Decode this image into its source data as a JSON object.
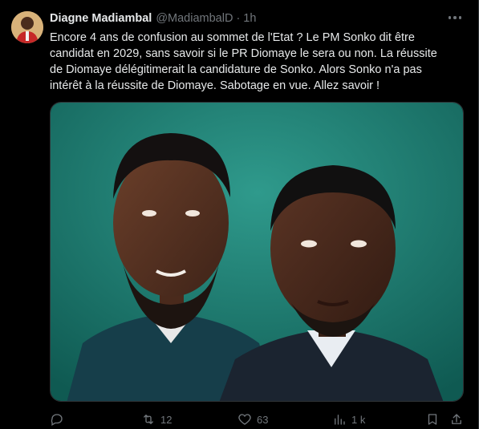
{
  "tweet": {
    "author_name": "Diagne Madiambal",
    "handle": "@MadiambalD",
    "separator": "·",
    "time": "1h",
    "text": "Encore 4 ans de confusion au sommet de l'Etat ? Le PM Sonko dit être\ncandidat en 2029, sans savoir si le PR Diomaye le sera ou non. La réussite\nde Diomaye délégitimerait la candidature de Sonko. Alors Sonko n'a pas\nintérêt à la réussite de Diomaye. Sabotage en vue. Allez savoir !"
  },
  "actions": {
    "replies": "",
    "reposts": "12",
    "likes": "63",
    "views": "1 k"
  },
  "icons": {
    "more": "more-horizontal-icon",
    "reply": "reply-icon",
    "repost": "repost-icon",
    "like": "heart-icon",
    "views": "views-icon",
    "bookmark": "bookmark-icon",
    "share": "share-icon"
  },
  "colors": {
    "background": "#000000",
    "text": "#e7e9ea",
    "muted": "#71767b",
    "media_background": "#1f7a6e"
  }
}
